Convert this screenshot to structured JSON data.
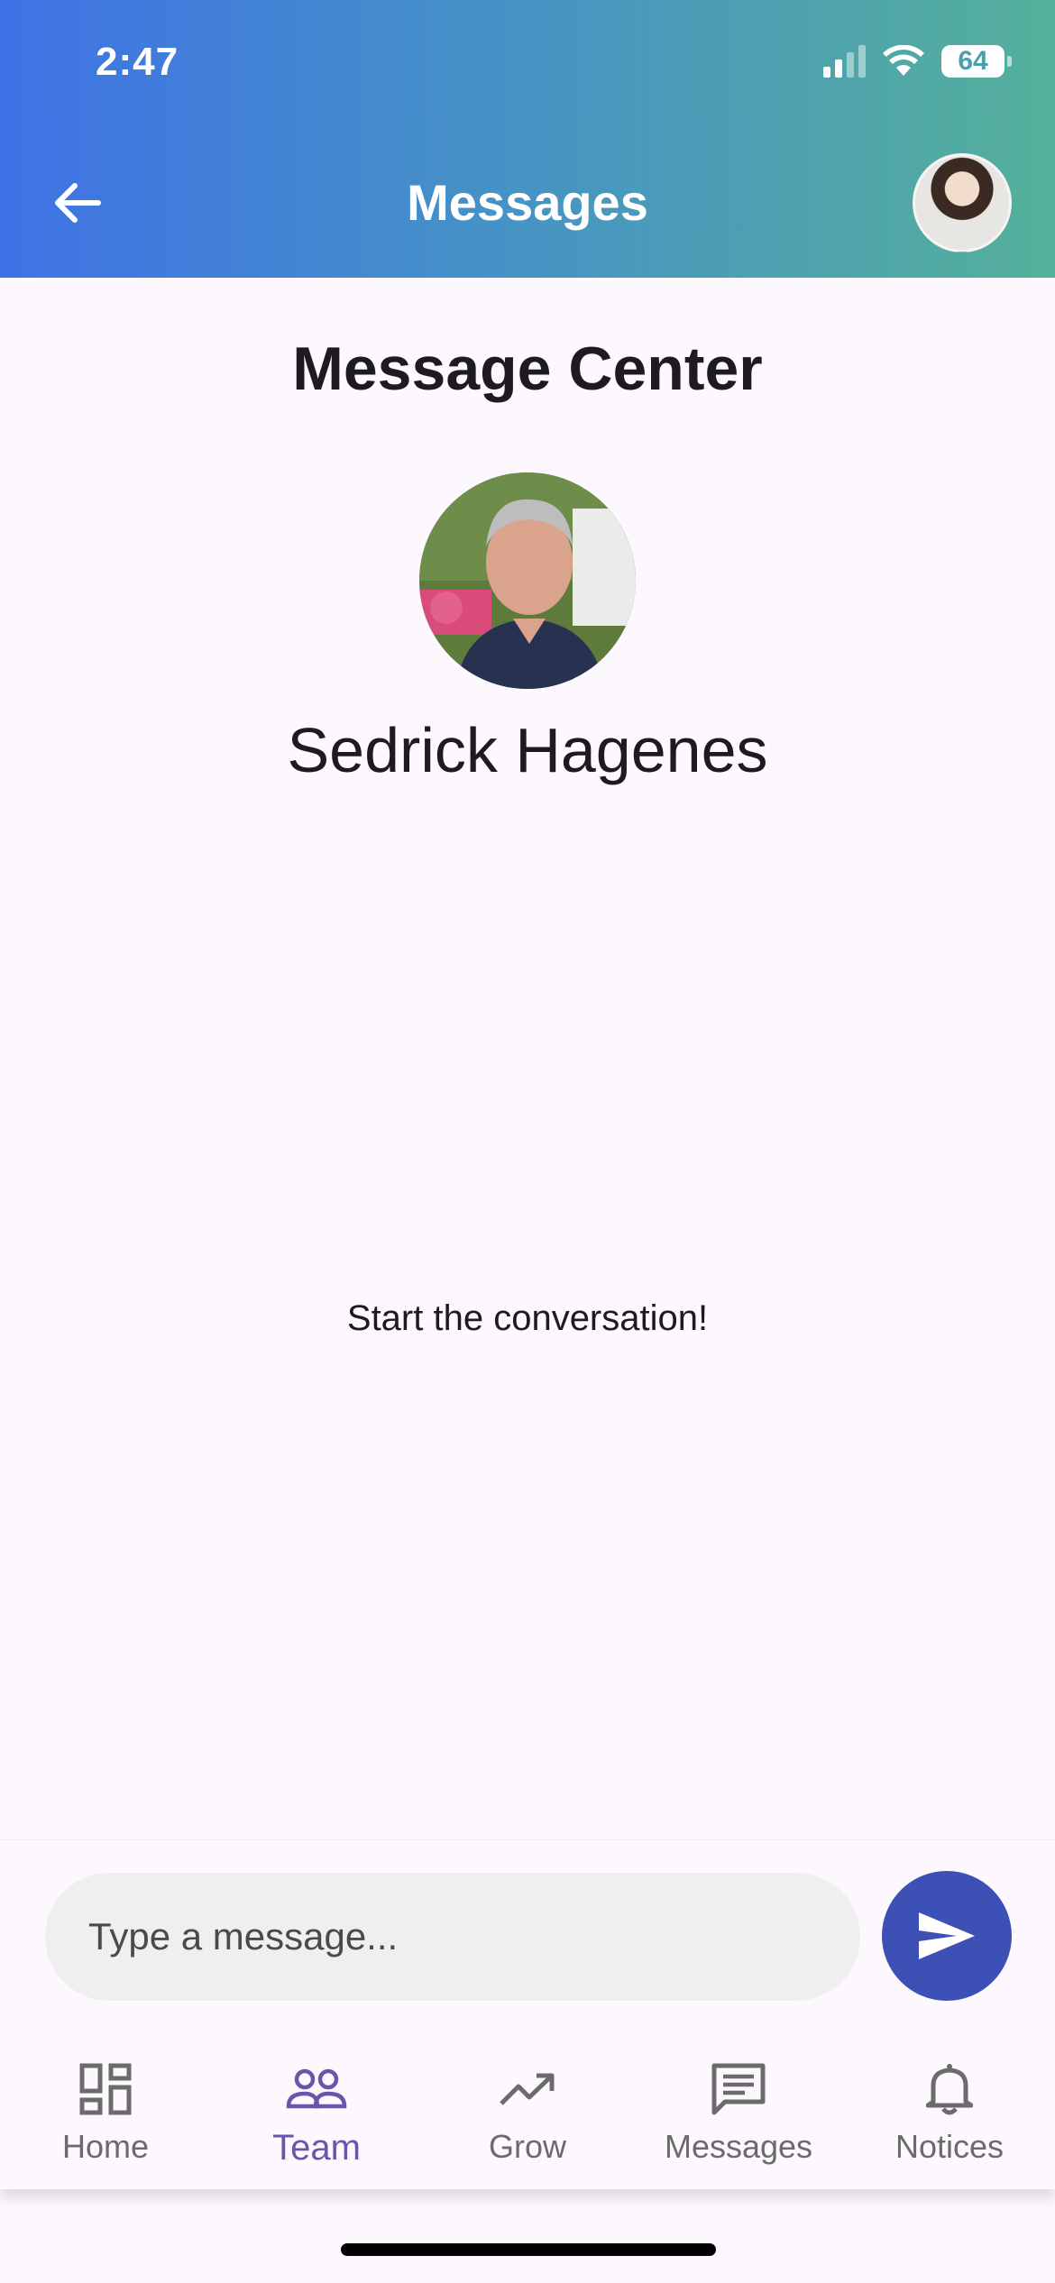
{
  "status_bar": {
    "time": "2:47",
    "battery": "64"
  },
  "header": {
    "title": "Messages"
  },
  "main": {
    "title": "Message Center",
    "contact_name": "Sedrick Hagenes",
    "empty_state": "Start the conversation!"
  },
  "composer": {
    "placeholder": "Type a message..."
  },
  "bottom_nav": {
    "items": [
      {
        "label": "Home",
        "icon": "dashboard-icon"
      },
      {
        "label": "Team",
        "icon": "people-icon",
        "active": true
      },
      {
        "label": "Grow",
        "icon": "trending-up-icon"
      },
      {
        "label": "Messages",
        "icon": "message-icon"
      },
      {
        "label": "Notices",
        "icon": "bell-icon"
      }
    ]
  },
  "colors": {
    "header_gradient_start": "#3f72e6",
    "header_gradient_end": "#55b09a",
    "send_button": "#3d50b5",
    "active_nav": "#6a55a8"
  }
}
